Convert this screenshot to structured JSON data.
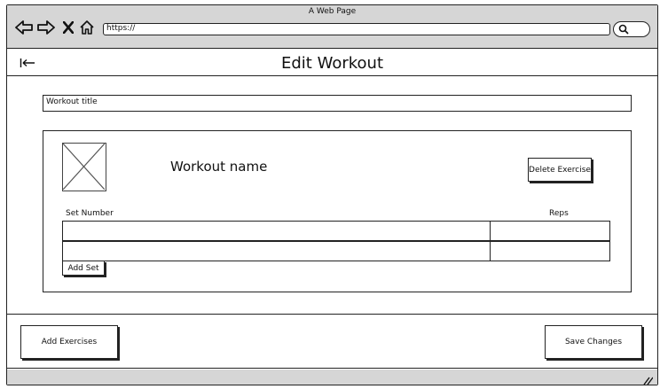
{
  "window": {
    "title": "A Web Page",
    "url": "https://"
  },
  "header": {
    "title": "Edit Workout"
  },
  "form": {
    "title_placeholder": "Workout title"
  },
  "exercise": {
    "name": "Workout name",
    "delete_label": "Delete Exercise",
    "columns": {
      "set_number": "Set Number",
      "reps": "Reps"
    },
    "set_rows": 2,
    "add_set_label": "Add Set"
  },
  "footer": {
    "add_exercises_label": "Add Exercises",
    "save_label": "Save Changes"
  },
  "icons": [
    "back-arrow-icon",
    "forward-arrow-icon",
    "close-icon",
    "home-icon",
    "search-icon",
    "collapse-left-icon",
    "image-placeholder-icon",
    "resize-grip-icon"
  ]
}
